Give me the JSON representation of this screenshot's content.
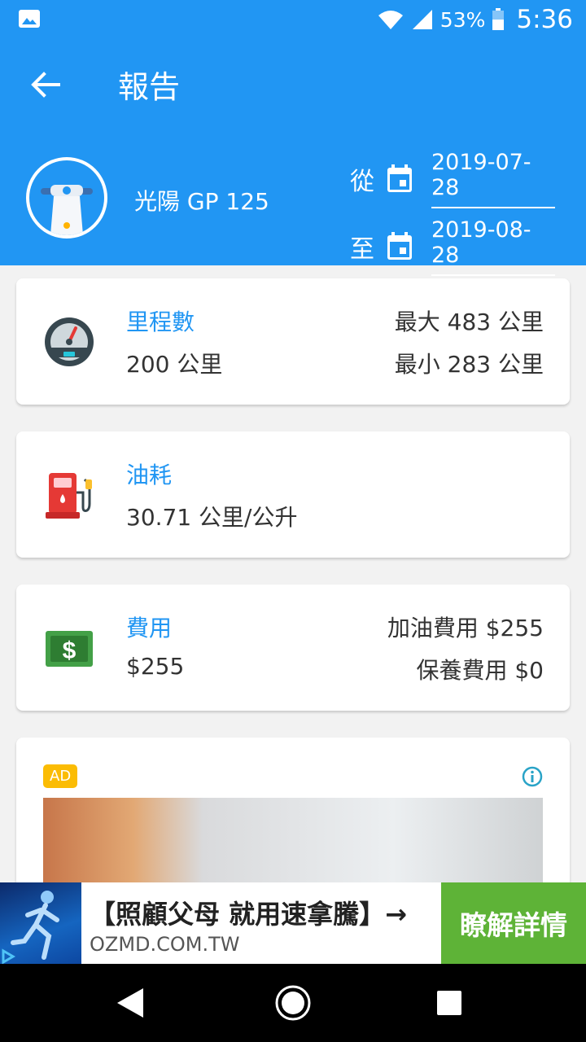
{
  "status_bar": {
    "battery": "53%",
    "time": "5:36"
  },
  "header": {
    "title": "報告",
    "vehicle_name": "光陽 GP 125",
    "from_label": "從",
    "from_date": "2019-07-28",
    "to_label": "至",
    "to_date": "2019-08-28"
  },
  "cards": {
    "mileage": {
      "label": "里程數",
      "value": "200 公里",
      "max": "最大 483 公里",
      "min": "最小 283 公里"
    },
    "fuel": {
      "label": "油耗",
      "value": "30.71 公里/公升"
    },
    "cost": {
      "label": "費用",
      "value": "$255",
      "fuel_cost": "加油費用 $255",
      "maintenance_cost": "保養費用 $0"
    }
  },
  "ad": {
    "badge": "AD"
  },
  "banner": {
    "headline": "【照顧父母 就用速拿騰】→",
    "url": "OZMD.COM.TW",
    "cta": "瞭解詳情"
  },
  "colors": {
    "primary": "#2196f3",
    "cta_green": "#5eb337",
    "ad_badge": "#fbbc04"
  }
}
